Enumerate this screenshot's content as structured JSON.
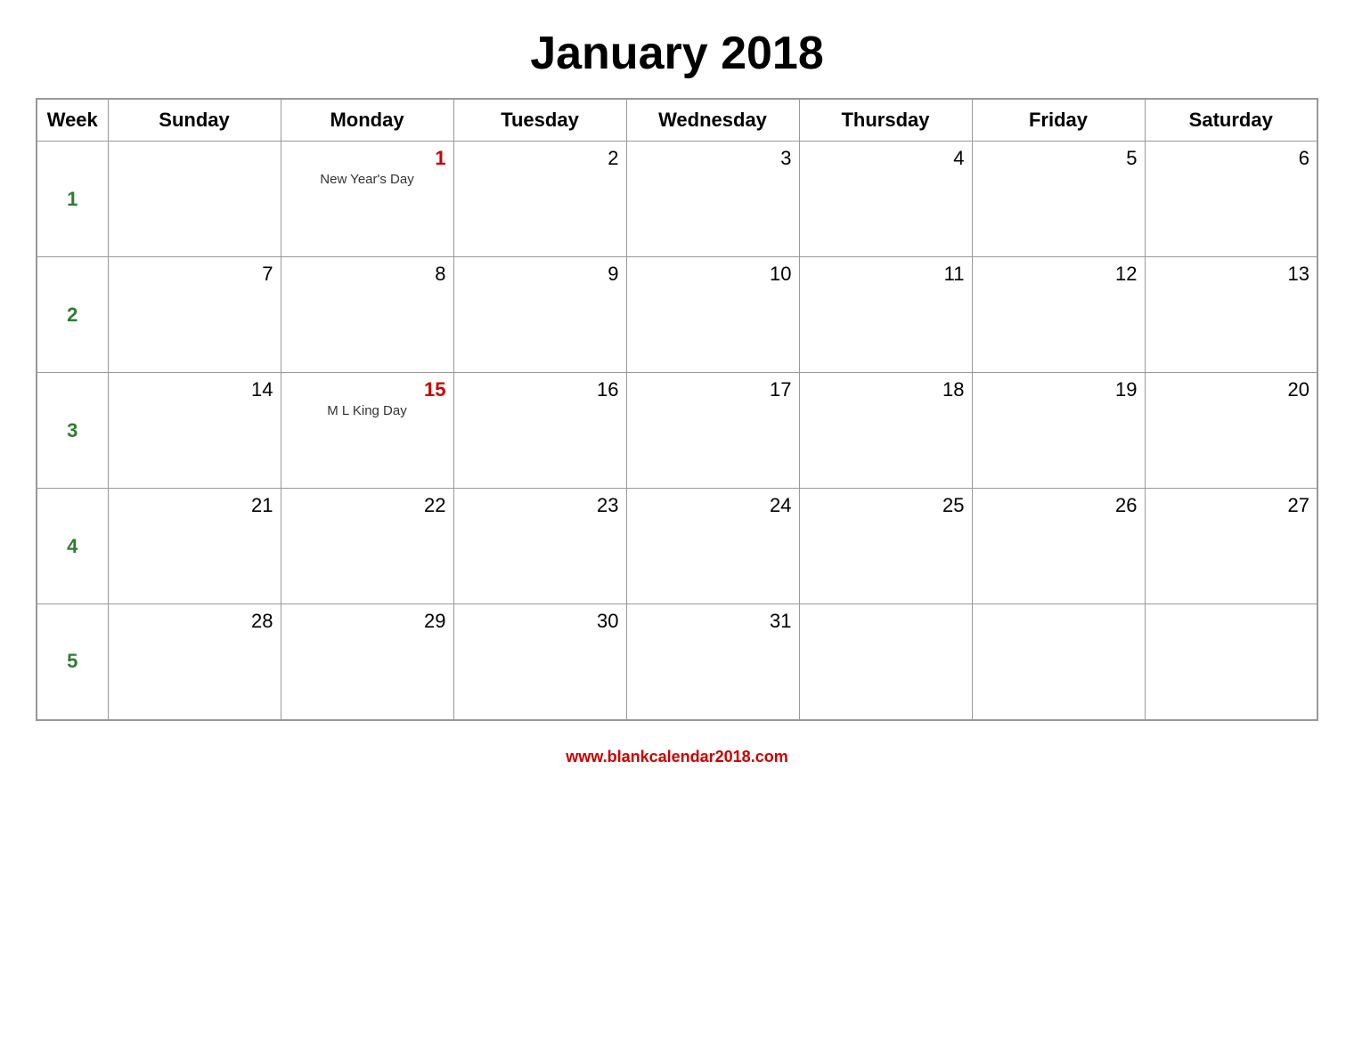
{
  "title": "January 2018",
  "website": "www.blankcalendar2018.com",
  "columns": [
    "Week",
    "Sunday",
    "Monday",
    "Tuesday",
    "Wednesday",
    "Thursday",
    "Friday",
    "Saturday"
  ],
  "weeks": [
    {
      "week_num": "1",
      "days": [
        {
          "day": "",
          "holiday": ""
        },
        {
          "day": "1",
          "holiday": "New Year's Day",
          "red": true
        },
        {
          "day": "2",
          "holiday": ""
        },
        {
          "day": "3",
          "holiday": ""
        },
        {
          "day": "4",
          "holiday": ""
        },
        {
          "day": "5",
          "holiday": ""
        },
        {
          "day": "6",
          "holiday": ""
        }
      ]
    },
    {
      "week_num": "2",
      "days": [
        {
          "day": "7",
          "holiday": ""
        },
        {
          "day": "8",
          "holiday": ""
        },
        {
          "day": "9",
          "holiday": ""
        },
        {
          "day": "10",
          "holiday": ""
        },
        {
          "day": "11",
          "holiday": ""
        },
        {
          "day": "12",
          "holiday": ""
        },
        {
          "day": "13",
          "holiday": ""
        }
      ]
    },
    {
      "week_num": "3",
      "days": [
        {
          "day": "14",
          "holiday": ""
        },
        {
          "day": "15",
          "holiday": "M L King Day",
          "red": true
        },
        {
          "day": "16",
          "holiday": ""
        },
        {
          "day": "17",
          "holiday": ""
        },
        {
          "day": "18",
          "holiday": ""
        },
        {
          "day": "19",
          "holiday": ""
        },
        {
          "day": "20",
          "holiday": ""
        }
      ]
    },
    {
      "week_num": "4",
      "days": [
        {
          "day": "21",
          "holiday": ""
        },
        {
          "day": "22",
          "holiday": ""
        },
        {
          "day": "23",
          "holiday": ""
        },
        {
          "day": "24",
          "holiday": ""
        },
        {
          "day": "25",
          "holiday": ""
        },
        {
          "day": "26",
          "holiday": ""
        },
        {
          "day": "27",
          "holiday": ""
        }
      ]
    },
    {
      "week_num": "5",
      "days": [
        {
          "day": "28",
          "holiday": ""
        },
        {
          "day": "29",
          "holiday": ""
        },
        {
          "day": "30",
          "holiday": ""
        },
        {
          "day": "31",
          "holiday": ""
        },
        {
          "day": "",
          "holiday": ""
        },
        {
          "day": "",
          "holiday": ""
        },
        {
          "day": "",
          "holiday": ""
        }
      ]
    }
  ]
}
